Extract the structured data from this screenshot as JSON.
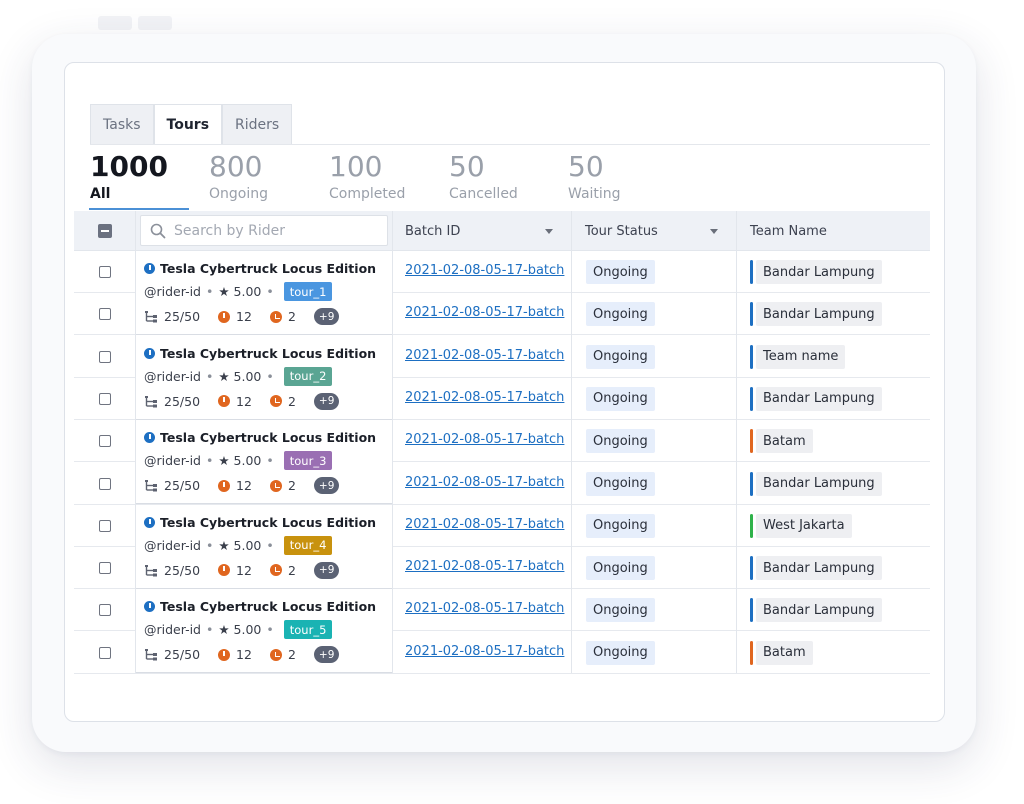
{
  "tabs": [
    {
      "label": "Tasks",
      "active": false
    },
    {
      "label": "Tours",
      "active": true
    },
    {
      "label": "Riders",
      "active": false
    }
  ],
  "stats": [
    {
      "count": "1000",
      "label": "All",
      "active": true
    },
    {
      "count": "800",
      "label": "Ongoing",
      "active": false
    },
    {
      "count": "100",
      "label": "Completed",
      "active": false
    },
    {
      "count": "50",
      "label": "Cancelled",
      "active": false
    },
    {
      "count": "50",
      "label": "Waiting",
      "active": false
    }
  ],
  "search": {
    "placeholder": "Search by Rider",
    "value": ""
  },
  "columns": {
    "batch_id": "Batch ID",
    "tour_status": "Tour Status",
    "team_name": "Team Name"
  },
  "colors": {
    "accent": "#1d6fc2",
    "blue": "#1d6fc2",
    "orange": "#e0661f",
    "green": "#2fb24a"
  },
  "tours": [
    {
      "title": "Tesla Cybertruck Locus Edition",
      "rider": "@rider-id",
      "rating": "★ 5.00",
      "tag": "tour_1",
      "tag_color": "#4a96e0",
      "tasks": "25/50",
      "alerts": "12",
      "late": "2",
      "more": "+9"
    },
    {
      "title": "Tesla Cybertruck Locus Edition",
      "rider": "@rider-id",
      "rating": "★ 5.00",
      "tag": "tour_2",
      "tag_color": "#5aa593",
      "tasks": "25/50",
      "alerts": "12",
      "late": "2",
      "more": "+9"
    },
    {
      "title": "Tesla Cybertruck Locus Edition",
      "rider": "@rider-id",
      "rating": "★ 5.00",
      "tag": "tour_3",
      "tag_color": "#9a6fb3",
      "tasks": "25/50",
      "alerts": "12",
      "late": "2",
      "more": "+9"
    },
    {
      "title": "Tesla Cybertruck Locus Edition",
      "rider": "@rider-id",
      "rating": "★ 5.00",
      "tag": "tour_4",
      "tag_color": "#c8920e",
      "tasks": "25/50",
      "alerts": "12",
      "late": "2",
      "more": "+9"
    },
    {
      "title": "Tesla Cybertruck Locus Edition",
      "rider": "@rider-id",
      "rating": "★ 5.00",
      "tag": "tour_5",
      "tag_color": "#1ab3b3",
      "tasks": "25/50",
      "alerts": "12",
      "late": "2",
      "more": "+9"
    }
  ],
  "rows": [
    {
      "batch": "2021-02-08-05-17-batch",
      "status": "Ongoing",
      "team": "Bandar Lampung",
      "team_color": "#1d6fc2"
    },
    {
      "batch": "2021-02-08-05-17-batch",
      "status": "Ongoing",
      "team": "Bandar Lampung",
      "team_color": "#1d6fc2"
    },
    {
      "batch": "2021-02-08-05-17-batch",
      "status": "Ongoing",
      "team": "Team name",
      "team_color": "#1d6fc2"
    },
    {
      "batch": "2021-02-08-05-17-batch",
      "status": "Ongoing",
      "team": "Bandar Lampung",
      "team_color": "#1d6fc2"
    },
    {
      "batch": "2021-02-08-05-17-batch",
      "status": "Ongoing",
      "team": "Batam",
      "team_color": "#e0661f"
    },
    {
      "batch": "2021-02-08-05-17-batch",
      "status": "Ongoing",
      "team": "Bandar Lampung",
      "team_color": "#1d6fc2"
    },
    {
      "batch": "2021-02-08-05-17-batch",
      "status": "Ongoing",
      "team": "West Jakarta",
      "team_color": "#2fb24a"
    },
    {
      "batch": "2021-02-08-05-17-batch",
      "status": "Ongoing",
      "team": "Bandar Lampung",
      "team_color": "#1d6fc2"
    },
    {
      "batch": "2021-02-08-05-17-batch",
      "status": "Ongoing",
      "team": "Bandar Lampung",
      "team_color": "#1d6fc2"
    },
    {
      "batch": "2021-02-08-05-17-batch",
      "status": "Ongoing",
      "team": "Batam",
      "team_color": "#e0661f"
    }
  ]
}
